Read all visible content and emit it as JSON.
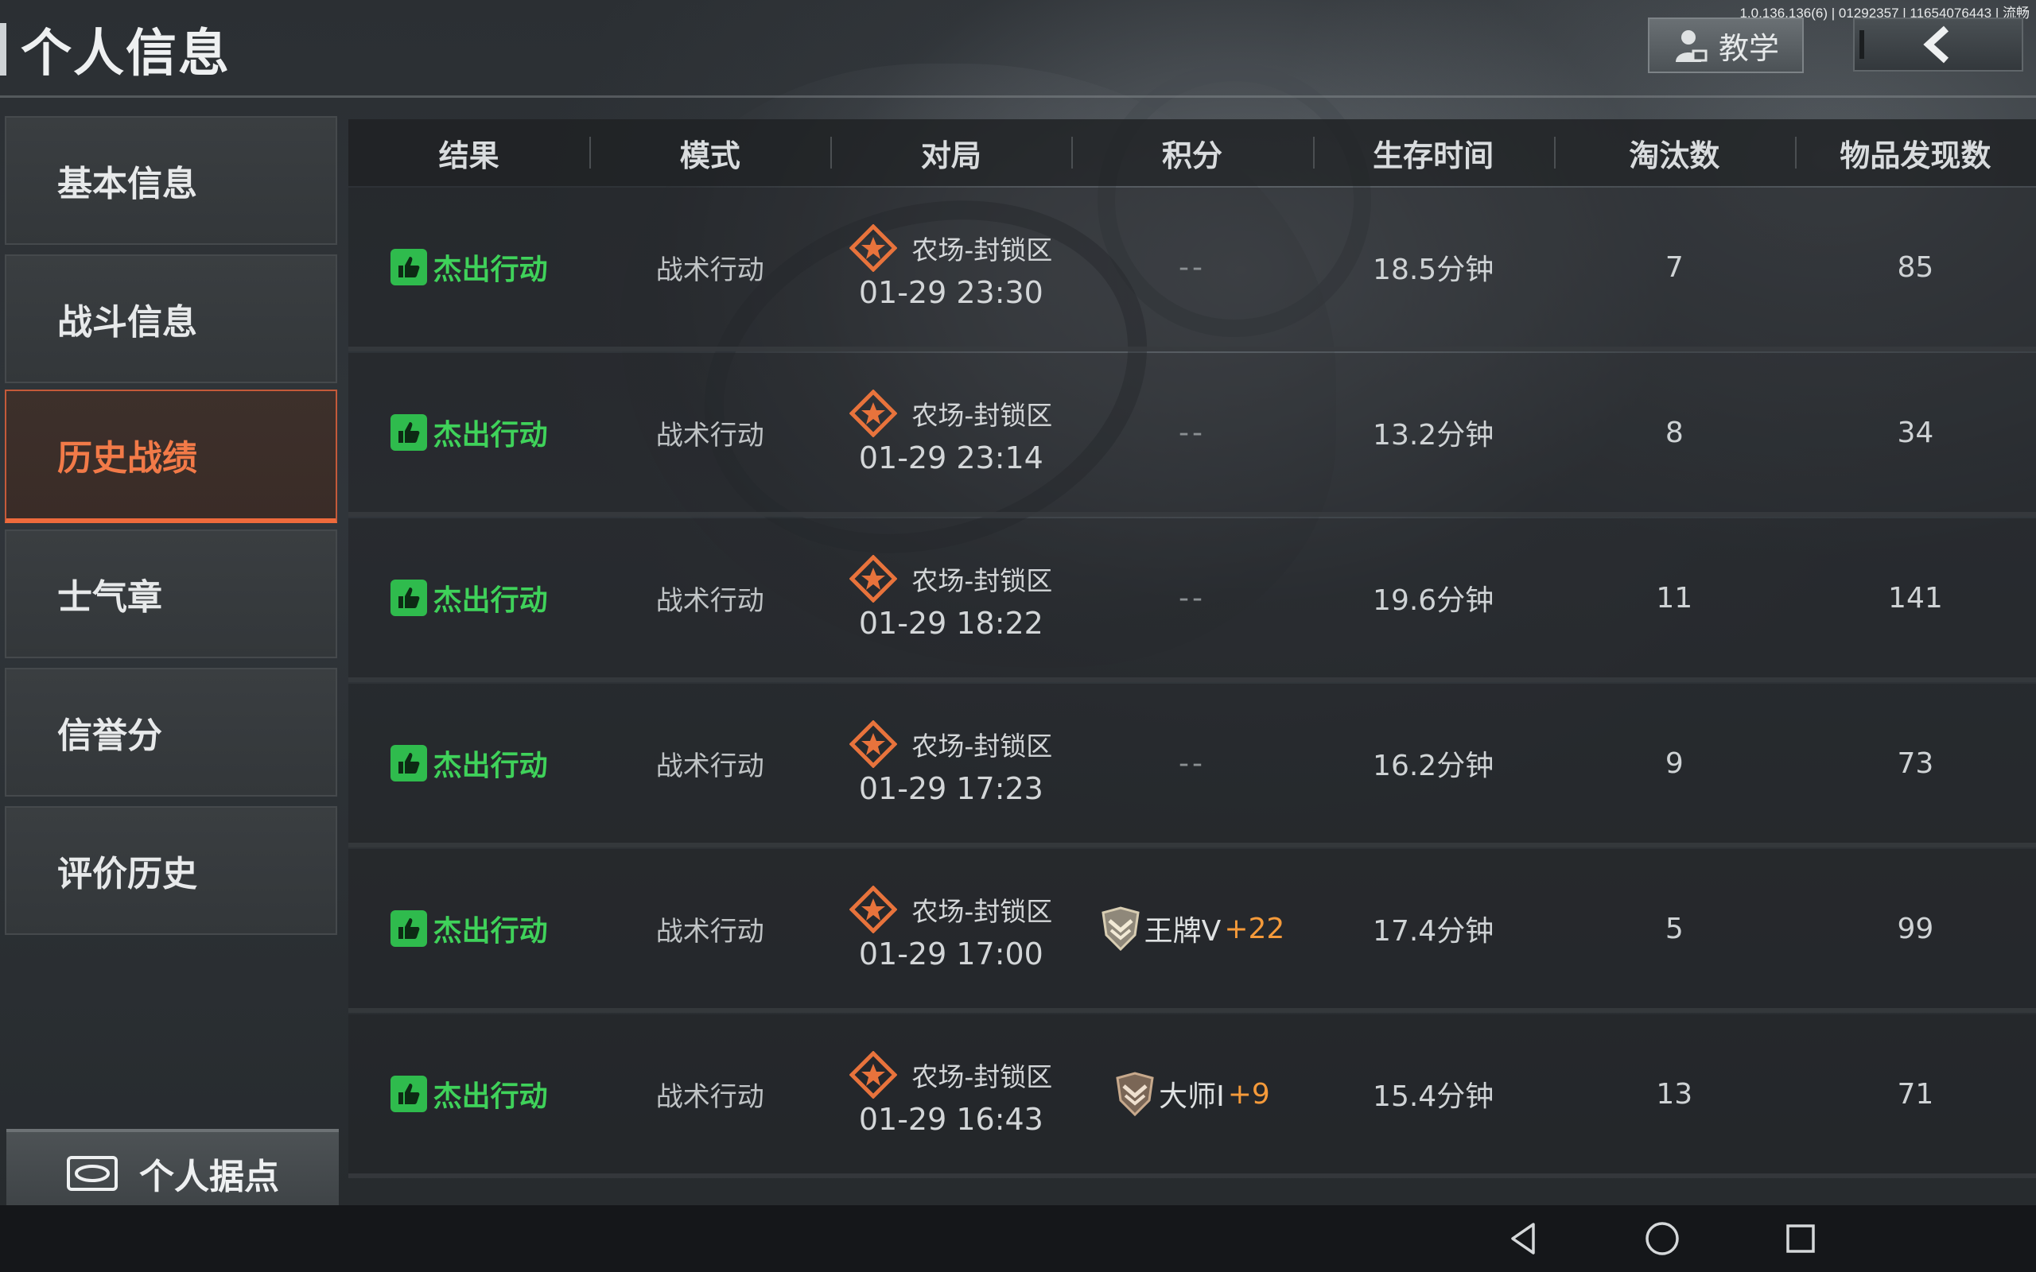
{
  "header": {
    "title": "个人信息",
    "version": "1.0.136.136(6) | 01292357 | 11654076443 | 流畅",
    "tutorial_label": "教学"
  },
  "sidebar": {
    "items": [
      {
        "label": "基本信息"
      },
      {
        "label": "战斗信息"
      },
      {
        "label": "历史战绩",
        "active": true
      },
      {
        "label": "士气章"
      },
      {
        "label": "信誉分"
      },
      {
        "label": "评价历史"
      }
    ],
    "base_label": "个人据点"
  },
  "table": {
    "columns": [
      "结果",
      "模式",
      "对局",
      "积分",
      "生存时间",
      "淘汰数",
      "物品发现数"
    ],
    "rows": [
      {
        "result": "杰出行动",
        "mode": "战术行动",
        "map": "农场-封锁区",
        "time": "01-29 23:30",
        "score": "--",
        "survival": "18.5分钟",
        "kills": "7",
        "items": "85"
      },
      {
        "result": "杰出行动",
        "mode": "战术行动",
        "map": "农场-封锁区",
        "time": "01-29 23:14",
        "score": "--",
        "survival": "13.2分钟",
        "kills": "8",
        "items": "34"
      },
      {
        "result": "杰出行动",
        "mode": "战术行动",
        "map": "农场-封锁区",
        "time": "01-29 18:22",
        "score": "--",
        "survival": "19.6分钟",
        "kills": "11",
        "items": "141"
      },
      {
        "result": "杰出行动",
        "mode": "战术行动",
        "map": "农场-封锁区",
        "time": "01-29 17:23",
        "score": "--",
        "survival": "16.2分钟",
        "kills": "9",
        "items": "73"
      },
      {
        "result": "杰出行动",
        "mode": "战术行动",
        "map": "农场-封锁区",
        "time": "01-29 17:00",
        "score_rank": "王牌V",
        "score_delta": "+22",
        "survival": "17.4分钟",
        "kills": "5",
        "items": "99"
      },
      {
        "result": "杰出行动",
        "mode": "战术行动",
        "map": "农场-封锁区",
        "time": "01-29 16:43",
        "score_rank": "大师I",
        "score_delta": "+9",
        "survival": "15.4分钟",
        "kills": "13",
        "items": "71"
      }
    ]
  },
  "colors": {
    "accent_orange": "#ee6a3c",
    "success_green": "#3fd25a",
    "score_delta": "#f59a3a"
  },
  "icons": {
    "tutorial": "instructor-icon",
    "back": "chevron-left-icon",
    "result": "thumbs-up-icon",
    "match": "tactical-star-icon",
    "rank_ace": "ace-rank-badge-icon",
    "rank_master": "master-rank-badge-icon",
    "base": "base-icon",
    "nav_back": "triangle-back-icon",
    "nav_home": "circle-home-icon",
    "nav_recent": "square-recent-icon"
  }
}
